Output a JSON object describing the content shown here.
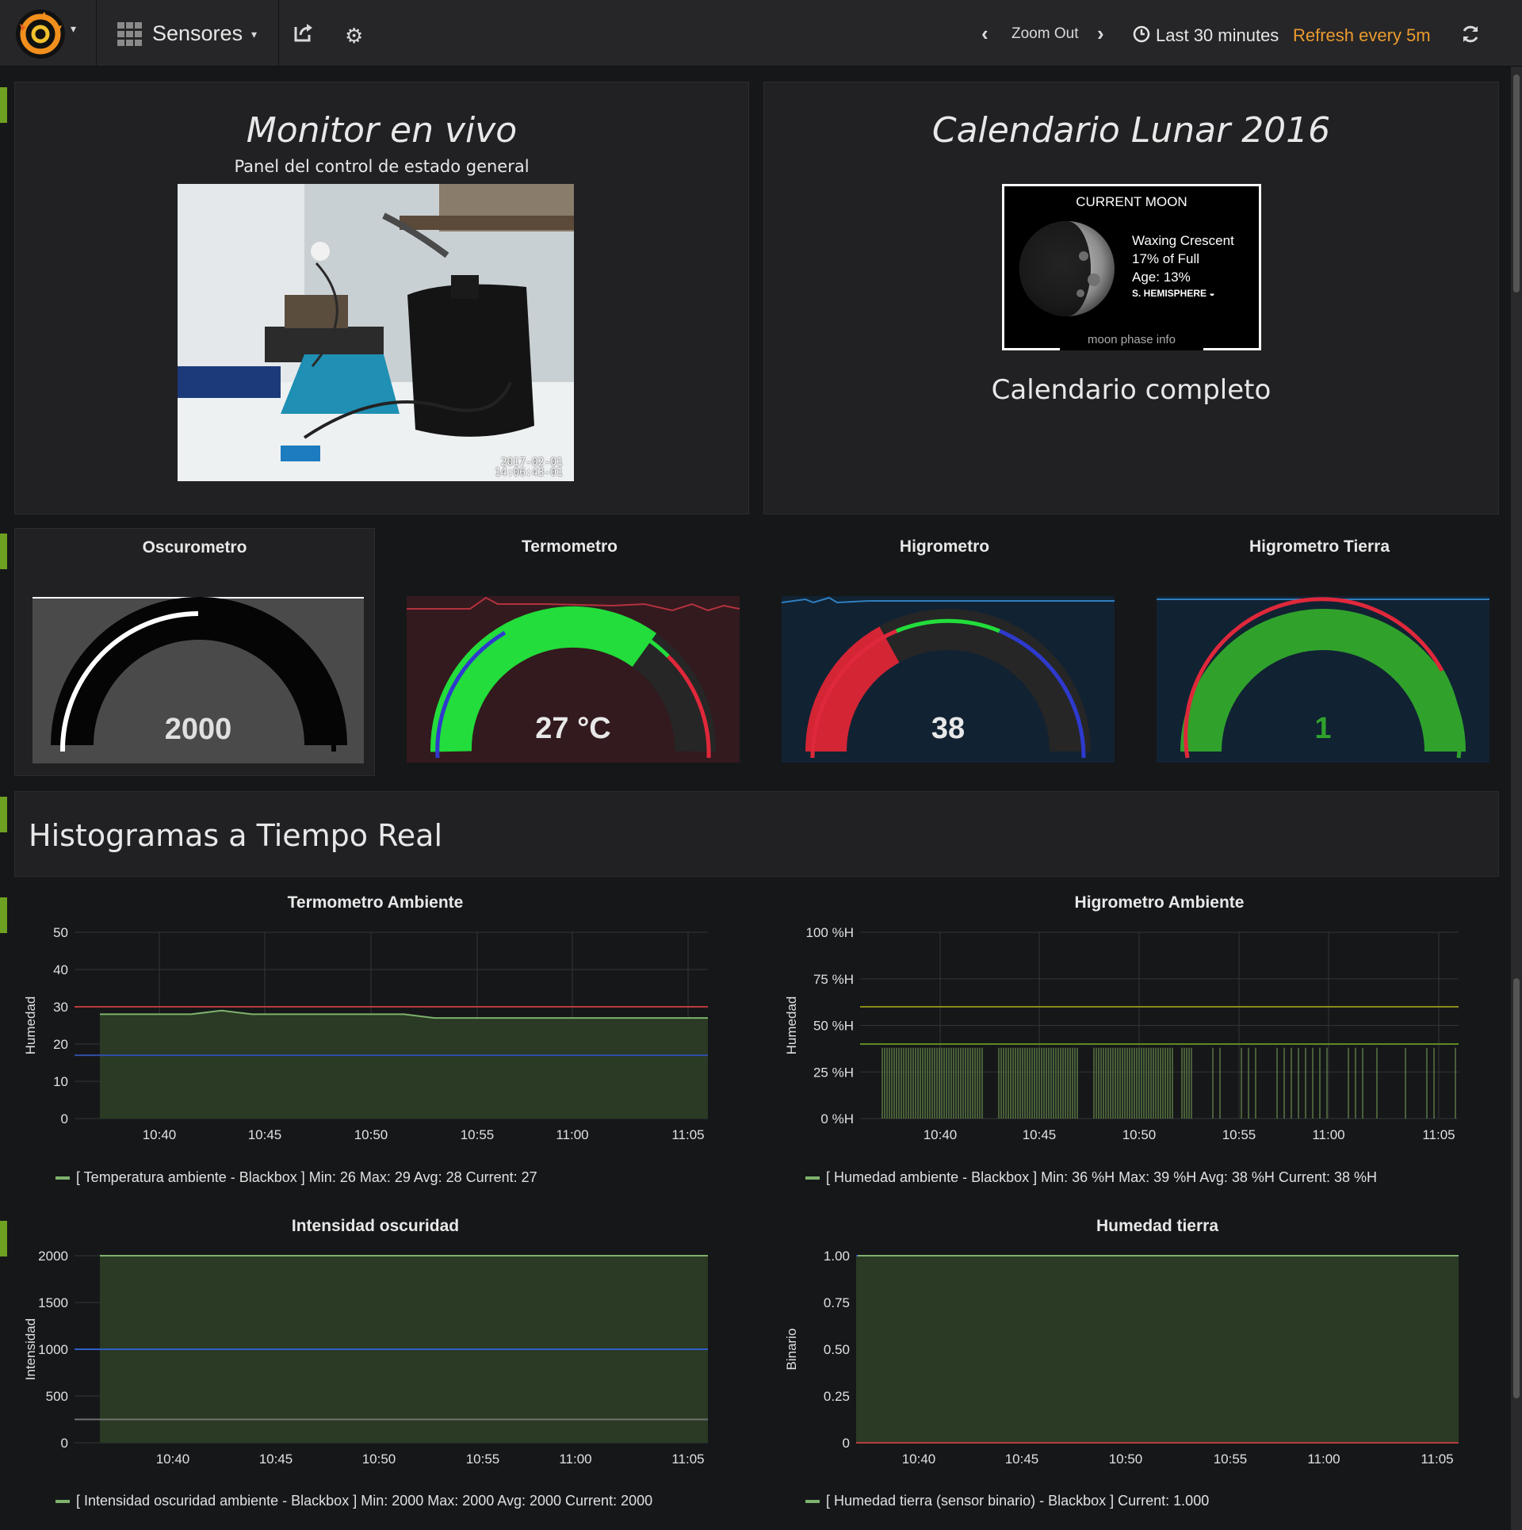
{
  "navbar": {
    "dashboard_title": "Sensores",
    "zoom_out": "Zoom Out",
    "time_range": "Last 30 minutes",
    "refresh": "Refresh every 5m"
  },
  "live_panel": {
    "title": "Monitor en vivo",
    "subtitle": "Panel del control de estado general",
    "camera_timestamp": "2017-02-01\n14:06:43-01"
  },
  "moon_panel": {
    "title": "Calendario Lunar 2016",
    "widget_header": "CURRENT MOON",
    "phase": "Waxing Crescent",
    "percent": "17% of Full",
    "age": "Age: 13%",
    "hemisphere": "S. HEMISPHERE",
    "footer": "moon phase info",
    "link": "Calendario completo"
  },
  "gauges": [
    {
      "title": "Oscurometro",
      "value": "2000"
    },
    {
      "title": "Termometro",
      "value": "27 °C"
    },
    {
      "title": "Higrometro",
      "value": "38"
    },
    {
      "title": "Higrometro Tierra",
      "value": "1"
    }
  ],
  "section": {
    "title": "Histogramas a Tiempo Real"
  },
  "chart_data": [
    {
      "type": "line",
      "title": "Termometro Ambiente",
      "ylabel": "Humedad",
      "yticks": [
        "50",
        "40",
        "30",
        "20",
        "10",
        "0"
      ],
      "ylim": [
        0,
        50
      ],
      "xticks": [
        "10:40",
        "10:45",
        "10:50",
        "10:55",
        "11:00",
        "11:05"
      ],
      "thresholds": [
        {
          "value": 30,
          "color": "#b83c3c"
        },
        {
          "value": 17,
          "color": "#2f4fa8"
        }
      ],
      "series": [
        {
          "name": "[ Temperatura ambiente - Blackbox ]",
          "values": [
            28,
            28,
            28,
            28,
            29,
            28,
            28,
            28,
            28,
            28,
            28,
            27,
            27,
            27,
            27,
            27,
            27,
            27,
            27,
            27,
            27
          ]
        }
      ],
      "legend": "[ Temperatura ambiente - Blackbox ]  Min: 26  Max: 29  Avg: 28  Current: 27"
    },
    {
      "type": "bar",
      "title": "Higrometro Ambiente",
      "ylabel": "Humedad",
      "yticks": [
        "100 %H",
        "75 %H",
        "50 %H",
        "25 %H",
        "0 %H"
      ],
      "ylim": [
        0,
        100
      ],
      "xticks": [
        "10:40",
        "10:45",
        "10:50",
        "10:55",
        "11:00",
        "11:05"
      ],
      "thresholds": [
        {
          "value": 60,
          "color": "#8c8c1a"
        },
        {
          "value": 40,
          "color": "#5f8a22"
        }
      ],
      "series": [
        {
          "name": "[ Humedad ambiente - Blackbox ]",
          "values": [
            38
          ]
        }
      ],
      "legend": "[ Humedad ambiente - Blackbox ]  Min: 36 %H  Max: 39 %H  Avg: 38 %H  Current: 38 %H"
    },
    {
      "type": "line",
      "title": "Intensidad oscuridad",
      "ylabel": "Intensidad",
      "yticks": [
        "2000",
        "1500",
        "1000",
        "500",
        "0"
      ],
      "ylim": [
        0,
        2000
      ],
      "xticks": [
        "10:40",
        "10:45",
        "10:50",
        "10:55",
        "11:00",
        "11:05"
      ],
      "thresholds": [
        {
          "value": 1000,
          "color": "#2f5fc8"
        },
        {
          "value": 250,
          "color": "#707070"
        }
      ],
      "series": [
        {
          "name": "[ Intensidad oscuridad ambiente - Blackbox ]",
          "values": [
            2000,
            2000
          ]
        }
      ],
      "legend": "[ Intensidad oscuridad ambiente - Blackbox ]  Min: 2000  Max: 2000  Avg: 2000  Current: 2000"
    },
    {
      "type": "line",
      "title": "Humedad tierra",
      "ylabel": "Binario",
      "yticks": [
        "1.00",
        "0.75",
        "0.50",
        "0.25",
        "0"
      ],
      "ylim": [
        0,
        1
      ],
      "xticks": [
        "10:40",
        "10:45",
        "10:50",
        "10:55",
        "11:00",
        "11:05"
      ],
      "thresholds": [
        {
          "value": 0,
          "color": "#b83c3c"
        }
      ],
      "series": [
        {
          "name": "[ Humedad tierra (sensor binario) - Blackbox ]",
          "values": [
            1,
            1
          ]
        }
      ],
      "legend": "[ Humedad tierra (sensor binario) - Blackbox ]  Current: 1.000"
    }
  ]
}
